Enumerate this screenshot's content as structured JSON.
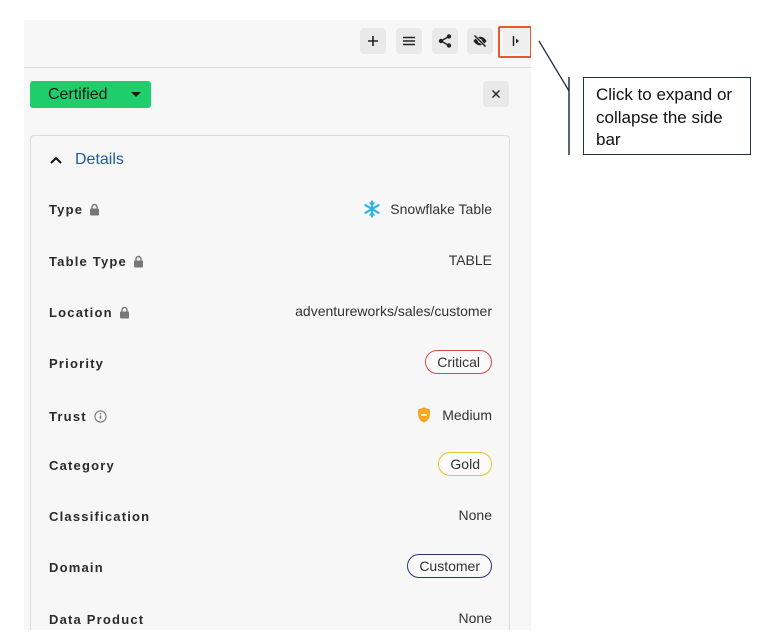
{
  "toolbar": {
    "add_icon": "plus-icon",
    "menu_icon": "hamburger-icon",
    "share_icon": "share-icon",
    "visibility_icon": "eye-off-icon",
    "collapse_icon": "sidebar-collapse-icon"
  },
  "status": {
    "label": "Certified",
    "color": "#1dce6a"
  },
  "details": {
    "title": "Details",
    "rows": [
      {
        "key": "Type",
        "locked": true,
        "value": "Snowflake Table",
        "icon": "snowflake-icon"
      },
      {
        "key": "Table Type",
        "locked": true,
        "value": "TABLE"
      },
      {
        "key": "Location",
        "locked": true,
        "value": "adventureworks/sales/customer"
      },
      {
        "key": "Priority",
        "value": "Critical",
        "pill_color": "#d94848"
      },
      {
        "key": "Trust",
        "info": true,
        "value": "Medium",
        "icon": "shield-medium-icon"
      },
      {
        "key": "Category",
        "value": "Gold",
        "pill_color": "#e6c42a"
      },
      {
        "key": "Classification",
        "value": "None"
      },
      {
        "key": "Domain",
        "value": "Customer",
        "pill_color": "#27367a"
      },
      {
        "key": "Data Product",
        "value": "None"
      }
    ]
  },
  "callout": {
    "text": "Click to expand or collapse the side bar"
  },
  "colors": {
    "highlight": "#e85a2a",
    "link": "#1f5a9c"
  }
}
